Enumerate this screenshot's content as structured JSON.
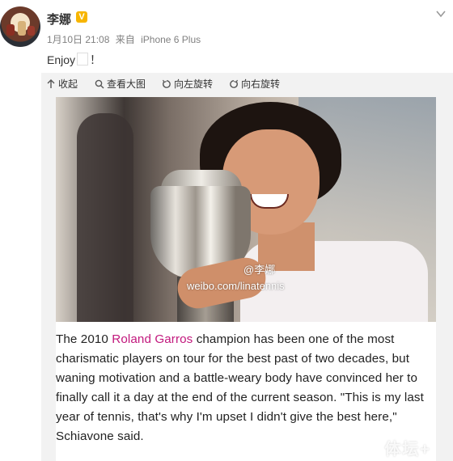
{
  "post": {
    "author": "李娜",
    "verified_mark": "V",
    "date": "1月10日 21:08",
    "source_prefix": "来自",
    "source_device": "iPhone 6 Plus",
    "text_main": "Enjoy",
    "text_tail": "！"
  },
  "toolbar": {
    "collapse_label": "收起",
    "view_large_label": "查看大图",
    "rotate_left_label": "向左旋转",
    "rotate_right_label": "向右旋转"
  },
  "image": {
    "watermark_logo": "@李娜",
    "watermark_url": "weibo.com/linatennis",
    "caption_before": "The 2010 ",
    "caption_highlight": "Roland Garros",
    "caption_after": " champion has been one of the most charismatic players on tour for the best past of two decades, but waning motivation and a battle-weary body have convinced her to finally call it a day at the end of the current season. \"This is my last year of tennis, that's why I'm upset I didn't give the best here,\" Schiavone said.",
    "site_watermark": "体坛+"
  },
  "colors": {
    "highlight": "#c2187d",
    "verified": "#f7b500"
  }
}
